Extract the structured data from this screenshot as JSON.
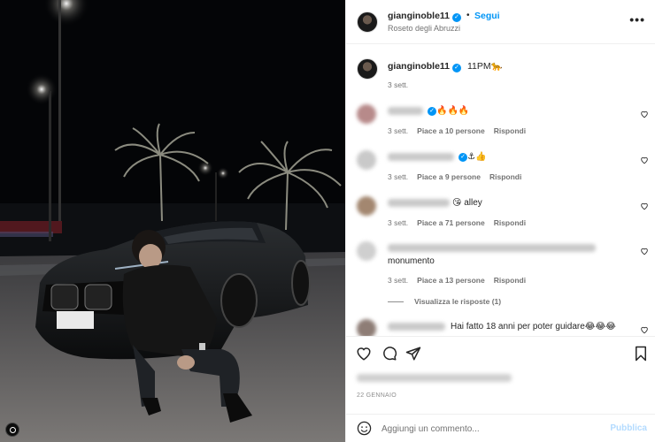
{
  "post": {
    "username": "gianginoble11",
    "follow_label": "Segui",
    "separator": "•",
    "location": "Roseto degli Abruzzi",
    "more_label": "•••"
  },
  "caption": {
    "username": "gianginoble11",
    "text": "11PM🐆",
    "time": "3 sett."
  },
  "comments": [
    {
      "text": "🔥🔥🔥",
      "time": "3 sett.",
      "likes": "Piace a 10 persone",
      "reply": "Rispondi"
    },
    {
      "text": "⚓👍",
      "time": "3 sett.",
      "likes": "Piace a 9 persone",
      "reply": "Rispondi"
    },
    {
      "text": "😘 alley",
      "time": "3 sett.",
      "likes": "Piace a 71 persone",
      "reply": "Rispondi"
    },
    {
      "text": "monumento",
      "time": "3 sett.",
      "likes": "Piace a 13 persone",
      "reply": "Rispondi",
      "view_replies": "Visualizza le risposte (1)"
    },
    {
      "text": "Hai fatto 18 anni per poter guidare😂😂😂"
    }
  ],
  "footer": {
    "date": "22 GENNAIO",
    "comment_placeholder": "Aggiungi un commento...",
    "publish_label": "Pubblica"
  },
  "icons": {
    "header_avatar": "avatar",
    "verified": "verified-badge-icon",
    "like": "heart-icon",
    "comment": "comment-icon",
    "share": "share-icon",
    "save": "bookmark-icon",
    "emoji": "emoji-icon"
  },
  "colors": {
    "accent": "#0095f6",
    "publish_disabled": "#b3dbff",
    "muted_text": "#737373"
  }
}
